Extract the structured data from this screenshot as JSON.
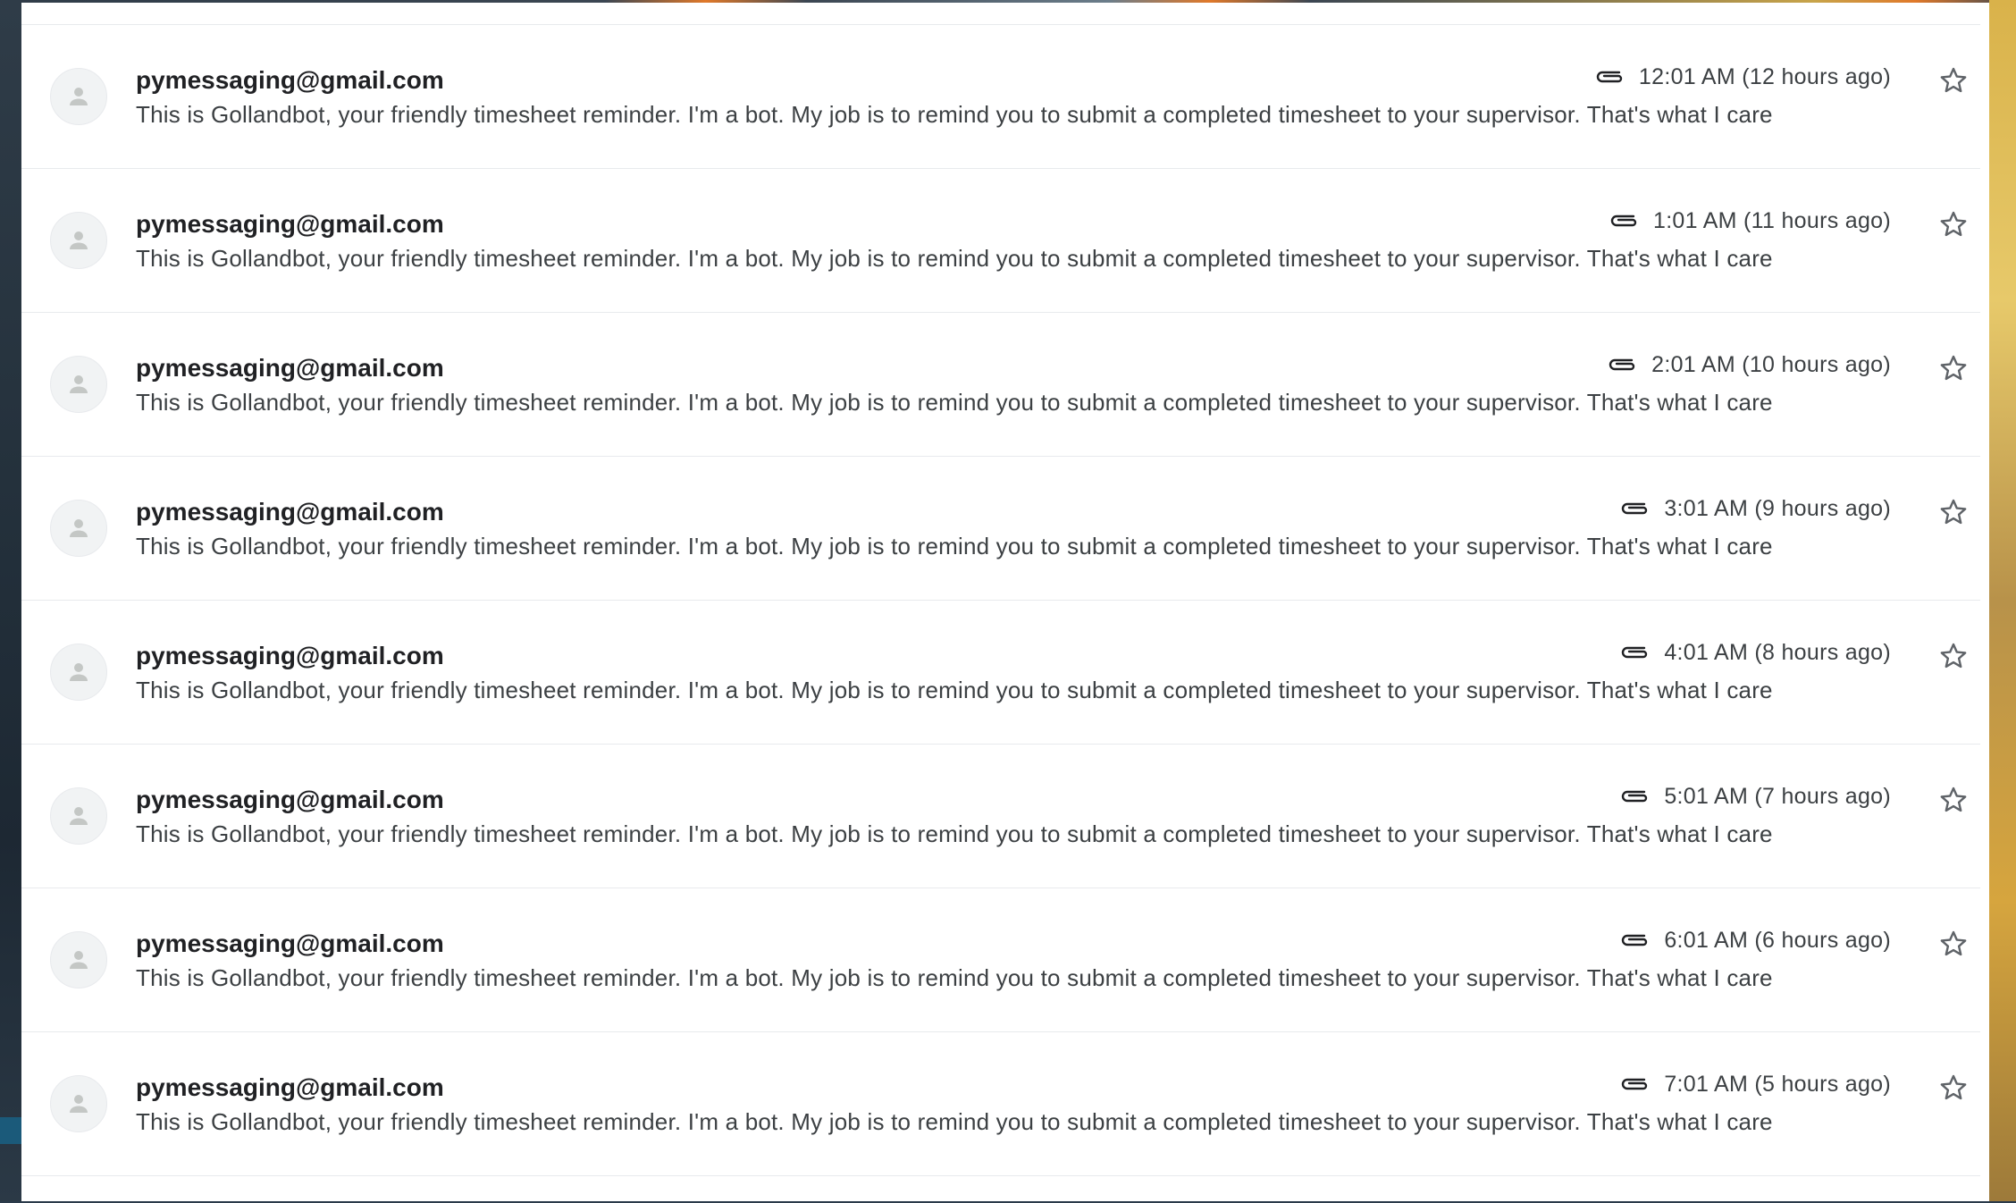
{
  "emails": [
    {
      "sender": "pymessaging@gmail.com",
      "snippet": "This is Gollandbot, your friendly timesheet reminder. I'm a bot. My job is to remind you to submit a completed timesheet to your supervisor. That's what I care",
      "time": "12:01 AM (12 hours ago)",
      "has_attachment": true,
      "starred": false
    },
    {
      "sender": "pymessaging@gmail.com",
      "snippet": "This is Gollandbot, your friendly timesheet reminder. I'm a bot. My job is to remind you to submit a completed timesheet to your supervisor. That's what I care",
      "time": "1:01 AM (11 hours ago)",
      "has_attachment": true,
      "starred": false
    },
    {
      "sender": "pymessaging@gmail.com",
      "snippet": "This is Gollandbot, your friendly timesheet reminder. I'm a bot. My job is to remind you to submit a completed timesheet to your supervisor. That's what I care",
      "time": "2:01 AM (10 hours ago)",
      "has_attachment": true,
      "starred": false
    },
    {
      "sender": "pymessaging@gmail.com",
      "snippet": "This is Gollandbot, your friendly timesheet reminder. I'm a bot. My job is to remind you to submit a completed timesheet to your supervisor. That's what I care",
      "time": "3:01 AM (9 hours ago)",
      "has_attachment": true,
      "starred": false
    },
    {
      "sender": "pymessaging@gmail.com",
      "snippet": "This is Gollandbot, your friendly timesheet reminder. I'm a bot. My job is to remind you to submit a completed timesheet to your supervisor. That's what I care",
      "time": "4:01 AM (8 hours ago)",
      "has_attachment": true,
      "starred": false
    },
    {
      "sender": "pymessaging@gmail.com",
      "snippet": "This is Gollandbot, your friendly timesheet reminder. I'm a bot. My job is to remind you to submit a completed timesheet to your supervisor. That's what I care",
      "time": "5:01 AM (7 hours ago)",
      "has_attachment": true,
      "starred": false
    },
    {
      "sender": "pymessaging@gmail.com",
      "snippet": "This is Gollandbot, your friendly timesheet reminder. I'm a bot. My job is to remind you to submit a completed timesheet to your supervisor. That's what I care",
      "time": "6:01 AM (6 hours ago)",
      "has_attachment": true,
      "starred": false
    },
    {
      "sender": "pymessaging@gmail.com",
      "snippet": "This is Gollandbot, your friendly timesheet reminder. I'm a bot. My job is to remind you to submit a completed timesheet to your supervisor. That's what I care",
      "time": "7:01 AM (5 hours ago)",
      "has_attachment": true,
      "starred": false
    }
  ],
  "icons": {
    "avatar": "person-icon",
    "attachment": "paperclip-icon",
    "star": "star-outline-icon"
  },
  "colors": {
    "sender_text": "#202124",
    "snippet_text": "#3c4043",
    "divider": "#e8eaed",
    "icon_gray": "#5f6368",
    "avatar_bg": "#f1f3f4"
  }
}
